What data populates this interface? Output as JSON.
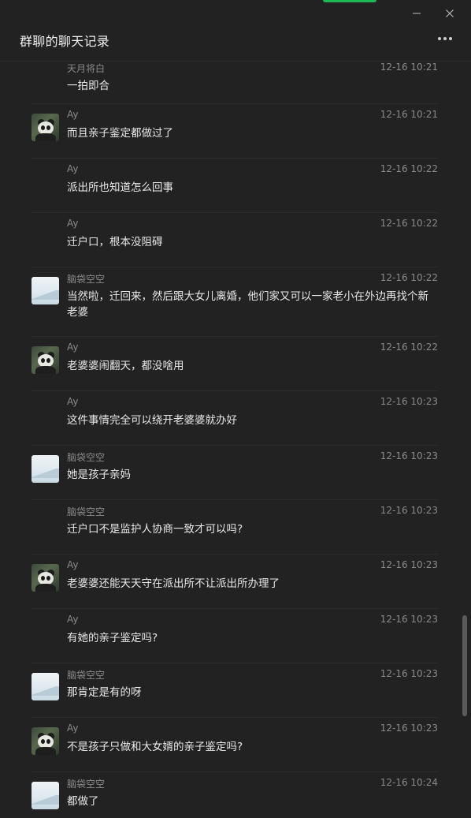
{
  "window": {
    "title": "群聊的聊天记录",
    "accent_color": "#1fb856",
    "controls": [
      "minimize-icon",
      "close-icon"
    ],
    "more_icon": "more-icon"
  },
  "messages": [
    {
      "sender": "天月将白",
      "time": "12-16 10:21",
      "text": "一拍即合",
      "avatar": null
    },
    {
      "sender": "Ay",
      "time": "12-16 10:21",
      "text": "而且亲子鉴定都做过了",
      "avatar": "panda"
    },
    {
      "sender": "Ay",
      "time": "12-16 10:22",
      "text": "派出所也知道怎么回事",
      "avatar": null
    },
    {
      "sender": "Ay",
      "time": "12-16 10:22",
      "text": "迁户口，根本没阻碍",
      "avatar": null
    },
    {
      "sender": "脑袋空空",
      "time": "12-16 10:22",
      "text": "当然啦，迁回来，然后跟大女儿离婚，他们家又可以一家老小在外边再找个新老婆",
      "avatar": "scenic"
    },
    {
      "sender": "Ay",
      "time": "12-16 10:22",
      "text": "老婆婆闹翻天，都没啥用",
      "avatar": "panda"
    },
    {
      "sender": "Ay",
      "time": "12-16 10:23",
      "text": "这件事情完全可以绕开老婆婆就办好",
      "avatar": null
    },
    {
      "sender": "脑袋空空",
      "time": "12-16 10:23",
      "text": "她是孩子亲妈",
      "avatar": "scenic"
    },
    {
      "sender": "脑袋空空",
      "time": "12-16 10:23",
      "text": "迁户口不是监护人协商一致才可以吗?",
      "avatar": null
    },
    {
      "sender": "Ay",
      "time": "12-16 10:23",
      "text": "老婆婆还能天天守在派出所不让派出所办理了",
      "avatar": "panda"
    },
    {
      "sender": "Ay",
      "time": "12-16 10:23",
      "text": "有她的亲子鉴定吗?",
      "avatar": null
    },
    {
      "sender": "脑袋空空",
      "time": "12-16 10:23",
      "text": "那肯定是有的呀",
      "avatar": "scenic"
    },
    {
      "sender": "Ay",
      "time": "12-16 10:23",
      "text": "不是孩子只做和大女婿的亲子鉴定吗?",
      "avatar": "panda"
    },
    {
      "sender": "脑袋空空",
      "time": "12-16 10:24",
      "text": "都做了",
      "avatar": "scenic"
    }
  ]
}
